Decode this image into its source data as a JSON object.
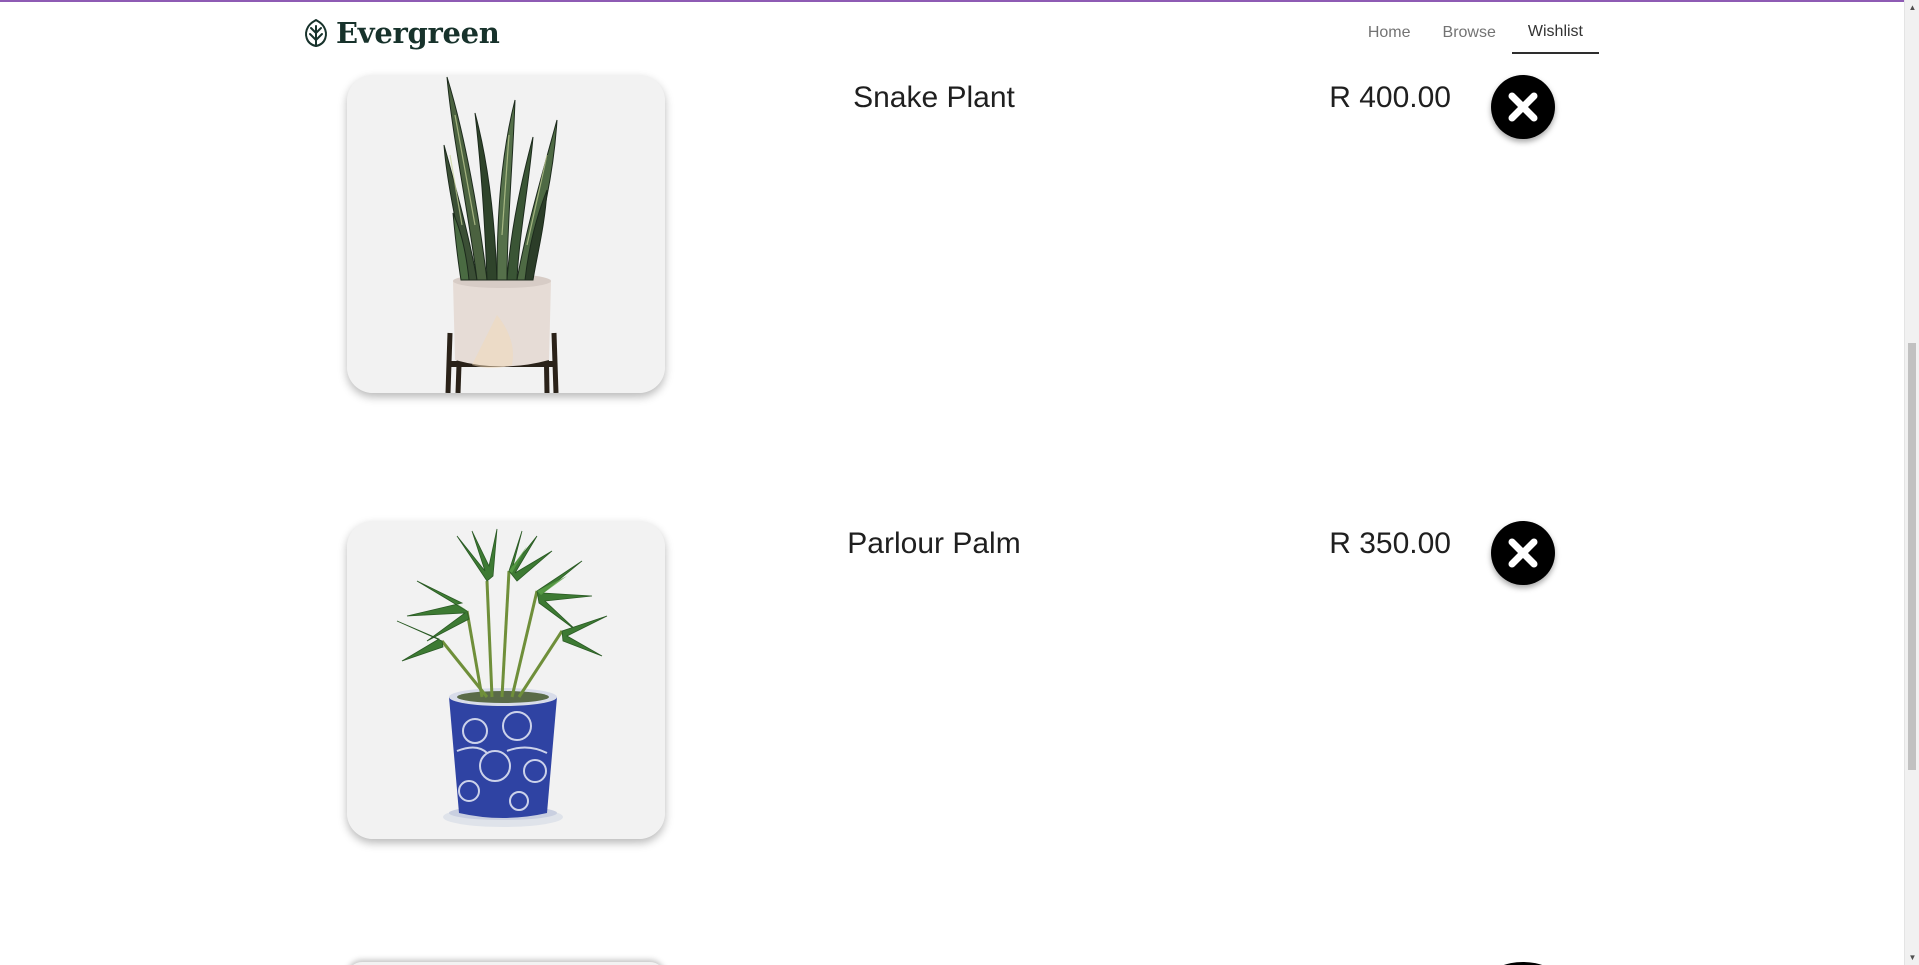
{
  "brand": {
    "name": "Evergreen",
    "icon": "leaf-icon",
    "color": "#17322b"
  },
  "nav": {
    "items": [
      {
        "label": "Home",
        "active": false
      },
      {
        "label": "Browse",
        "active": false
      },
      {
        "label": "Wishlist",
        "active": true
      }
    ]
  },
  "wishlist": {
    "items": [
      {
        "name": "Snake Plant",
        "price": "R 400.00",
        "image": "snake-plant-image",
        "remove_icon": "close-icon"
      },
      {
        "name": "Parlour Palm",
        "price": "R 350.00",
        "image": "parlour-palm-image",
        "remove_icon": "close-icon"
      }
    ]
  },
  "colors": {
    "accent_top_bar": "#8e5bb4",
    "remove_button": "#000000",
    "card_background": "#f2f2f2"
  }
}
